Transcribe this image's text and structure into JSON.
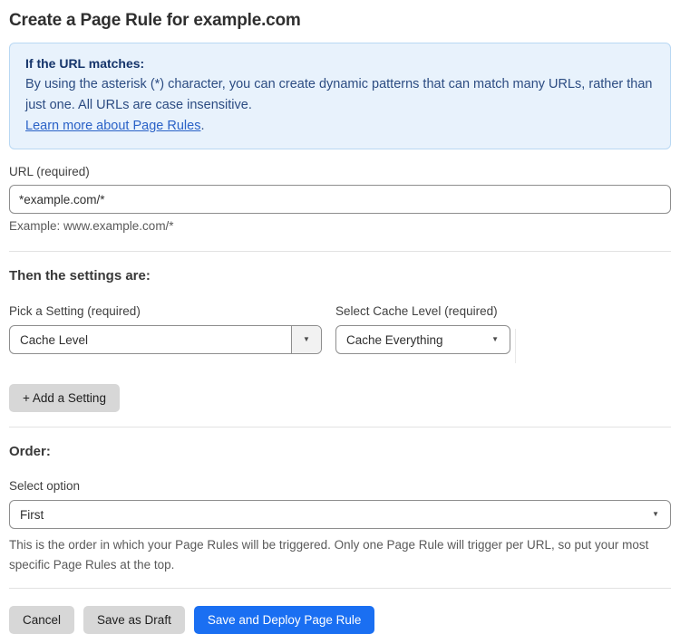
{
  "page": {
    "title": "Create a Page Rule for example.com"
  },
  "info_box": {
    "heading": "If the URL matches:",
    "body": "By using the asterisk (*) character, you can create dynamic patterns that can match many URLs, rather than just one. All URLs are case insensitive.",
    "link_label": "Learn more about Page Rules",
    "link_suffix": "."
  },
  "url_field": {
    "label": "URL (required)",
    "value": "*example.com/*",
    "helper": "Example: www.example.com/*"
  },
  "settings_section": {
    "heading": "Then the settings are:",
    "setting_picker": {
      "label": "Pick a Setting (required)",
      "value": "Cache Level"
    },
    "cache_level": {
      "label": "Select Cache Level (required)",
      "value": "Cache Everything"
    },
    "add_setting_label": "+ Add a Setting"
  },
  "order_section": {
    "heading": "Order:",
    "label": "Select option",
    "value": "First",
    "helper": "This is the order in which your Page Rules will be triggered. Only one Page Rule will trigger per URL, so put your most specific Page Rules at the top."
  },
  "actions": {
    "cancel": "Cancel",
    "save_draft": "Save as Draft",
    "save_deploy": "Save and Deploy Page Rule"
  },
  "icons": {
    "dropdown_arrow": "▼"
  },
  "colors": {
    "info_background": "#e8f2fc",
    "info_border": "#b9d8f3",
    "info_text": "#2c4c82",
    "link_blue": "#2a62c7",
    "primary_button_blue": "#1a6ff2",
    "secondary_button_gray": "#d7d7d7"
  }
}
